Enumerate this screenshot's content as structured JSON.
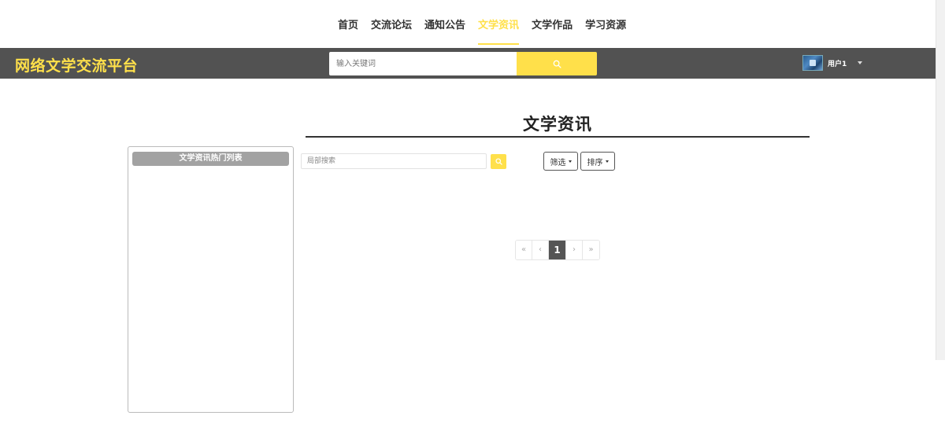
{
  "nav": {
    "items": [
      {
        "label": "首页",
        "active": false
      },
      {
        "label": "交流论坛",
        "active": false
      },
      {
        "label": "通知公告",
        "active": false
      },
      {
        "label": "文学资讯",
        "active": true
      },
      {
        "label": "文学作品",
        "active": false
      },
      {
        "label": "学习资源",
        "active": false
      }
    ]
  },
  "header": {
    "brand": "网络文学交流平台",
    "search": {
      "placeholder": "输入关键词",
      "value": "",
      "button_icon": "search-icon"
    },
    "user": {
      "name": "用户1",
      "avatar_icon": "avatar-image",
      "menu_icon": "caret-down-icon"
    }
  },
  "page": {
    "title": "文学资讯"
  },
  "sidebar": {
    "header": "文学资讯热门列表",
    "items": []
  },
  "toolbar": {
    "local_search": {
      "placeholder": "局部搜索",
      "value": ""
    },
    "filter_label": "筛选",
    "sort_label": "排序"
  },
  "pagination": {
    "first": "«",
    "prev": "‹",
    "current": "1",
    "next": "›",
    "last": "»"
  },
  "colors": {
    "accent": "#ffe04a",
    "header_bg": "#525252",
    "panel_header_bg": "#a2a2a2",
    "pagination_active": "#555555"
  }
}
